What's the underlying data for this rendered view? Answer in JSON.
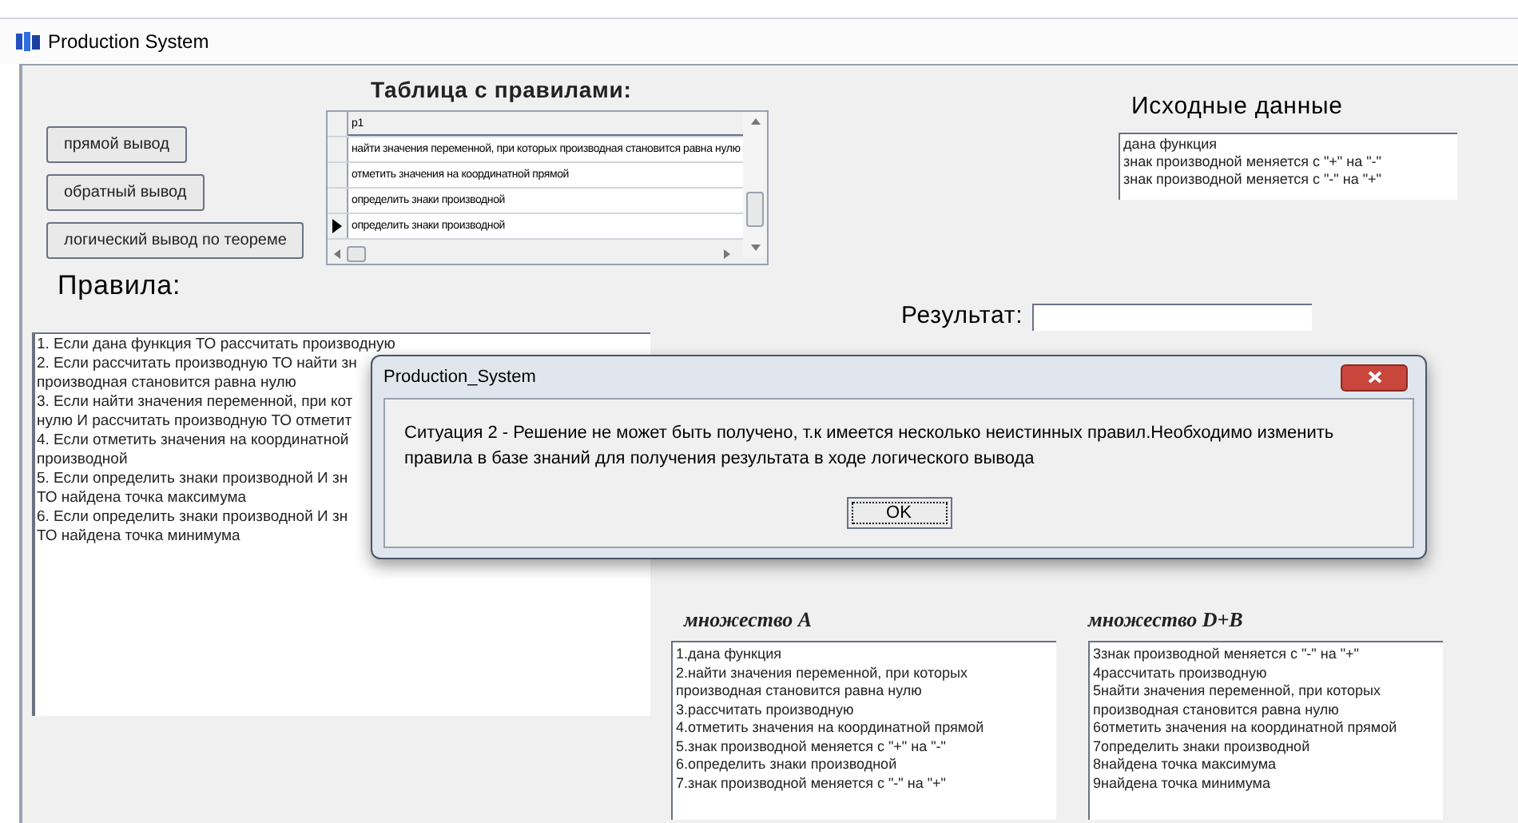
{
  "window": {
    "title": "Production System"
  },
  "buttons": [
    "прямой вывод",
    "обратный вывод",
    "логический вывод по теореме"
  ],
  "rules_table": {
    "title": "Таблица с правилами:",
    "columns": [
      "p1"
    ],
    "rows": [
      {
        "cells": [
          "найти значения переменной, при которых производная становится равна нулю"
        ],
        "selected": false
      },
      {
        "cells": [
          "отметить значения на координатной прямой"
        ],
        "selected": false
      },
      {
        "cells": [
          "определить знаки производной"
        ],
        "selected": false
      },
      {
        "cells": [
          "определить знаки производной"
        ],
        "selected": true
      }
    ]
  },
  "rules": {
    "label": "Правила:",
    "lines": [
      "1. Если дана функция ТО рассчитать производную",
      "2. Если рассчитать производную ТО найти зн",
      "производная становится равна нулю",
      "3. Если найти значения переменной, при кот",
      "нулю И рассчитать производную ТО отметит",
      "4. Если отметить значения на координатной",
      "производной",
      "5. Если определить знаки производной И зн",
      "ТО найдена точка максимума",
      "6. Если определить знаки производной И зн",
      "ТО найдена точка минимума"
    ]
  },
  "source_data": {
    "label": "Исходные данные",
    "lines": [
      "дана функция",
      "знак производной меняется с \"+\" на \"-\"",
      "знак производной меняется с \"-\" на \"+\""
    ]
  },
  "result": {
    "label": "Результат:"
  },
  "set_a": {
    "label": "множество A",
    "lines": [
      "1.дана функция",
      "2.найти значения переменной, при которых",
      "производная становится равна нулю",
      "3.рассчитать производную",
      "4.отметить значения на координатной прямой",
      "5.знак производной меняется с \"+\" на \"-\"",
      "6.определить знаки производной",
      "7.знак производной меняется с \"-\" на \"+\""
    ]
  },
  "set_db": {
    "label": "множество D+B",
    "lines": [
      "3знак производной меняется с \"-\" на \"+\"",
      "4рассчитать производную",
      "5найти значения переменной, при которых",
      "производная становится равна нулю",
      "6отметить значения на координатной прямой",
      "7определить знаки производной",
      "8найдена точка максимума",
      "9найдена точка минимума"
    ]
  },
  "dialog": {
    "title": "Production_System",
    "message": "Ситуация 2 - Решение не может быть получено, т.к имеется несколько неистинных правил.Необходимо изменить правила в базе знаний для получения результата в ходе логического вывода",
    "button": "OK"
  }
}
